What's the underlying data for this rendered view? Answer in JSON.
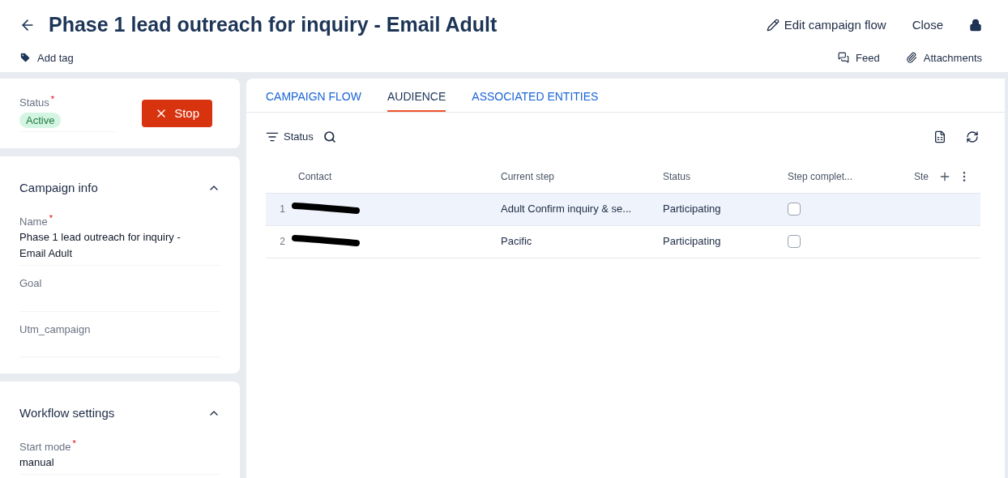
{
  "header": {
    "title": "Phase 1 lead outreach for inquiry - Email Adult",
    "add_tag": "Add tag",
    "actions": [
      "Edit campaign flow",
      "Close"
    ],
    "links": [
      "Feed",
      "Attachments"
    ]
  },
  "status_card": {
    "label": "Status",
    "required_mark": "*",
    "value": "Active",
    "stop_button": "Stop"
  },
  "sections": [
    {
      "title": "Campaign info",
      "expanded": true,
      "fields": [
        {
          "label": "Name",
          "required_mark": "*",
          "value": "Phase 1 lead outreach for inquiry - Email Adult"
        },
        {
          "label": "Goal"
        },
        {
          "label": "Utm_campaign"
        }
      ]
    },
    {
      "title": "Workflow settings",
      "expanded": true,
      "fields": [
        {
          "label": "Start mode",
          "required_mark": "*",
          "value": "manual"
        }
      ]
    }
  ],
  "tabs": [
    {
      "label": "CAMPAIGN FLOW",
      "selected": false
    },
    {
      "label": "AUDIENCE",
      "selected": true
    },
    {
      "label": "ASSOCIATED ENTITIES",
      "selected": false
    }
  ],
  "toolbar": {
    "filter": "Status"
  },
  "table": {
    "columns": [
      "Contact",
      "Current step",
      "Status",
      "Step complet...",
      "Ste"
    ],
    "rows": [
      {
        "number": "1",
        "current_step": "Adult Confirm inquiry & se...",
        "status": "Participating",
        "step_completed": false,
        "selected": true
      },
      {
        "number": "2",
        "current_step": "Pacific",
        "status": "Participating",
        "step_completed": false,
        "selected": false
      }
    ]
  }
}
